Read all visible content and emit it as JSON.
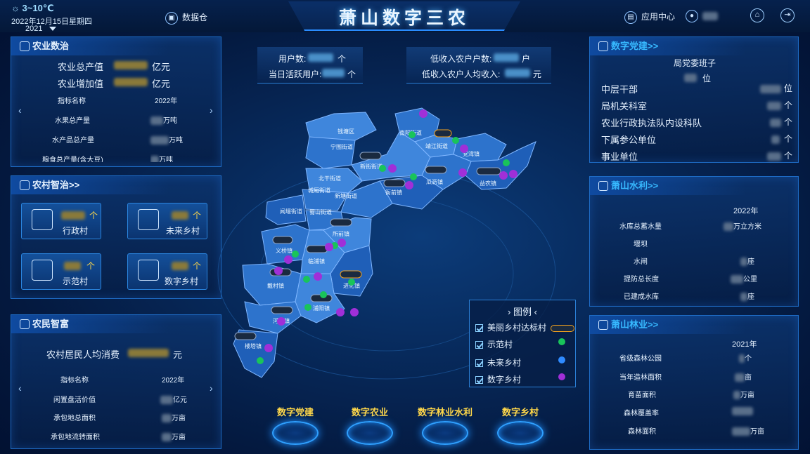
{
  "header": {
    "weather": "3~10℃",
    "date": "2022年12月15日星期四",
    "year_select": "2021",
    "data_warehouse": "数据仓",
    "title": "萧山数字三农",
    "app_center": "应用中心"
  },
  "agri_data": {
    "title": "农业数治",
    "output_label": "农业总产值",
    "added_label": "农业增加值",
    "unit": "亿元",
    "col_indicator": "指标名称",
    "col_year": "2022年",
    "rows": [
      {
        "name": "水果总产量",
        "unit": "万吨"
      },
      {
        "name": "水产品总产量",
        "unit": "万吨"
      },
      {
        "name": "粮食总产量(含大豆)",
        "unit": "万吨"
      }
    ]
  },
  "rural_gov": {
    "title": "农村智治>>",
    "cards": [
      {
        "label": "行政村",
        "unit": "个"
      },
      {
        "label": "未来乡村",
        "unit": "个"
      },
      {
        "label": "示范村",
        "unit": "个"
      },
      {
        "label": "数字乡村",
        "unit": "个"
      }
    ]
  },
  "farmer_rich": {
    "title": "农民智富",
    "consume_label": "农村居民人均消费",
    "consume_unit": "元",
    "col_indicator": "指标名称",
    "col_year": "2022年",
    "rows": [
      {
        "name": "闲置盘活价值",
        "unit": "亿元"
      },
      {
        "name": "承包地总面积",
        "unit": "万亩"
      },
      {
        "name": "承包地流转面积",
        "unit": "万亩"
      }
    ]
  },
  "stats": {
    "users_label": "用户数:",
    "users_unit": "个",
    "active_label": "当日活跃用户:",
    "active_unit": "个",
    "low_income_label": "低收入农户户数:",
    "low_income_unit": "户",
    "low_income_avg_label": "低收入农户人均收入:",
    "low_income_avg_unit": "元"
  },
  "map": {
    "labels": [
      "瓜沥镇",
      "南阳街道",
      "靖江街道",
      "党湾镇",
      "宁围街道",
      "新街街道",
      "衙前镇",
      "益农镇",
      "北干街道",
      "城厢街道",
      "新塘街道",
      "闻堰街道",
      "蜀山街道",
      "所前镇",
      "义桥镇",
      "临浦镇",
      "戴村镇",
      "进化镇",
      "浦阳镇",
      "河上镇",
      "楼塔镇",
      "瓜沥镇"
    ],
    "short_labels": [
      "衙前镇",
      "北干街道",
      "城厢街道",
      "新塘街道",
      "闻堰街道",
      "蜀山街道",
      "所前镇",
      "义桥镇",
      "临浦镇",
      "戴村镇",
      "进化镇",
      "浦阳镇",
      "河上镇",
      "楼塔镇",
      "宁围街道",
      "新街街道",
      "南阳街道",
      "靖江街道",
      "党湾镇",
      "益农镇",
      "瓜沥镇",
      "钱塘区"
    ]
  },
  "legend": {
    "title": "图例",
    "items": [
      {
        "label": "美丽乡村达标村",
        "color": "#f0a020"
      },
      {
        "label": "示范村",
        "color": "#19c45a"
      },
      {
        "label": "未来乡村",
        "color": "#2f8bff"
      },
      {
        "label": "数字乡村",
        "color": "#a02fd8"
      }
    ]
  },
  "bottom_nav": [
    "数字党建",
    "数字农业",
    "数字林业水利",
    "数字乡村"
  ],
  "party": {
    "title": "数字党建>>",
    "subtitle": "局党委班子",
    "sub_unit": "位",
    "rows": [
      {
        "name": "中层干部",
        "unit": "位"
      },
      {
        "name": "局机关科室",
        "unit": "个"
      },
      {
        "name": "农业行政执法队内设科队",
        "unit": "个"
      },
      {
        "name": "下属参公单位",
        "unit": "个"
      },
      {
        "name": "事业单位",
        "unit": "个"
      }
    ]
  },
  "water": {
    "title": "萧山水利>>",
    "year": "2022年",
    "rows": [
      {
        "name": "水库总蓄水量",
        "unit": "万立方米"
      },
      {
        "name": "堰坝",
        "unit": ""
      },
      {
        "name": "水闸",
        "unit": "座"
      },
      {
        "name": "提防总长度",
        "unit": "公里"
      },
      {
        "name": "已建成水库",
        "unit": "座"
      }
    ]
  },
  "forest": {
    "title": "萧山林业>>",
    "year": "2021年",
    "rows": [
      {
        "name": "省级森林公园",
        "unit": "个"
      },
      {
        "name": "当年造林面积",
        "unit": "亩"
      },
      {
        "name": "育苗面积",
        "unit": "万亩"
      },
      {
        "name": "森林覆盖率",
        "unit": ""
      },
      {
        "name": "森林面积",
        "unit": "万亩"
      }
    ]
  }
}
